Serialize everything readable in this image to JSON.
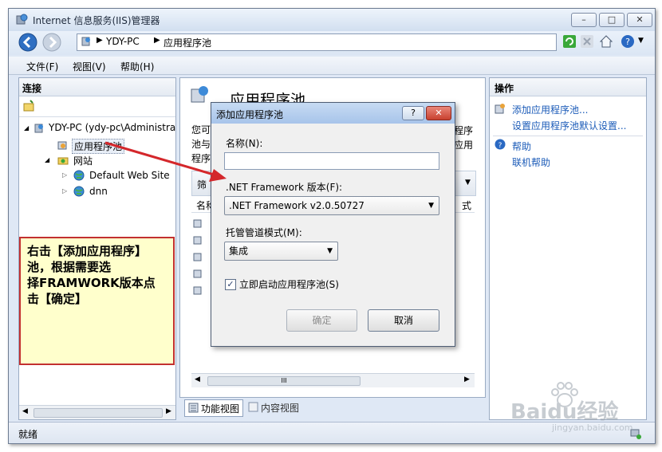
{
  "window": {
    "title": "Internet 信息服务(IIS)管理器",
    "min": "▭",
    "max": "▢",
    "close": "✕"
  },
  "address": {
    "crumbs": [
      "YDY-PC",
      "应用程序池"
    ]
  },
  "menu": [
    "文件(F)",
    "视图(V)",
    "帮助(H)"
  ],
  "connections": {
    "title": "连接",
    "tree": [
      "YDY-PC (ydy-pc\\Administra",
      "应用程序池",
      "网站",
      "Default Web Site",
      "dnn"
    ]
  },
  "center": {
    "title": "应用程序池",
    "desc_left": [
      "您可",
      "池与",
      "程序"
    ],
    "desc_right": [
      "程序",
      "应用"
    ],
    "filter_label": "筛",
    "col_name": "名称",
    "col_right": "式",
    "scroll_mark": "III",
    "tabs": [
      "功能视图",
      "内容视图"
    ]
  },
  "actions": {
    "title": "操作",
    "items": [
      "添加应用程序池...",
      "设置应用程序池默认设置..."
    ],
    "help": [
      "帮助",
      "联机帮助"
    ]
  },
  "status": "就绪",
  "dialog": {
    "title": "添加应用程序池",
    "help_btn": "?",
    "close_btn": "✕",
    "name_label": "名称(N):",
    "name_value": "",
    "fw_label": ".NET Framework 版本(F):",
    "fw_value": ".NET Framework v2.0.50727",
    "mode_label": "托管管道模式(M):",
    "mode_value": "集成",
    "autostart_label": "立即启动应用程序池(S)",
    "autostart_checked": true,
    "ok": "确定",
    "cancel": "取消"
  },
  "annotation": {
    "lines": [
      "右击【添加应用程序】",
      "池，根据需要选",
      "择FRAMWORK版本点",
      "击【确定】"
    ]
  },
  "watermark": {
    "brand": "Baidu经验",
    "url": "jingyan.baidu.com"
  },
  "colors": {
    "arrow": "#d4272b",
    "link": "#1b5bb8",
    "note_bg": "#ffffcc"
  }
}
